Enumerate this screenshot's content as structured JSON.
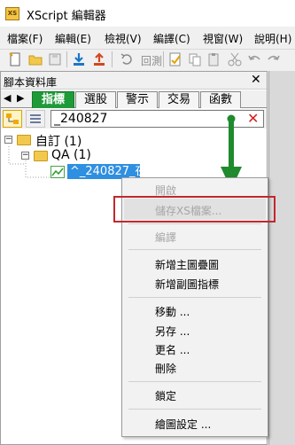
{
  "window": {
    "app_icon_text": "XS",
    "title": "XScript 編輯器"
  },
  "menubar": [
    "檔案(F)",
    "編輯(E)",
    "檢視(V)",
    "編譯(C)",
    "視窗(W)",
    "說明(H)"
  ],
  "toolbar": {
    "icons": [
      "new-file-icon",
      "open-folder-icon",
      "save-icon",
      "import-icon",
      "export-icon",
      "undo-icon",
      "backtest-icon",
      "compile-icon",
      "copy-icon",
      "paste-icon",
      "cut-icon",
      "delete-icon",
      "undo-arrow-icon",
      "redo-arrow-icon"
    ],
    "backtest_label": "回測"
  },
  "panel": {
    "title": "腳本資料庫",
    "close_glyph": "✕",
    "tabs": [
      "指標",
      "選股",
      "警示",
      "交易",
      "函數"
    ],
    "active_tab": "指標",
    "search": {
      "value": "_240827",
      "clear_glyph": "✕"
    }
  },
  "tree": {
    "expand_minus": "−",
    "root": "自訂 (1)",
    "child": "QA (1)",
    "item": "^_240827_夜盤"
  },
  "context_menu": {
    "items": [
      {
        "label": "開啟",
        "enabled": false
      },
      {
        "label": "儲存XS檔案...",
        "enabled": false
      },
      {
        "label": "編譯",
        "enabled": false
      },
      {
        "label": "新增主圖疊圖",
        "enabled": true
      },
      {
        "label": "新增副圖指標",
        "enabled": true
      },
      {
        "label": "移動 ...",
        "enabled": true
      },
      {
        "label": "另存 ...",
        "enabled": true
      },
      {
        "label": "更名 ...",
        "enabled": true
      },
      {
        "label": "刪除",
        "enabled": true
      },
      {
        "label": "鎖定",
        "enabled": true
      },
      {
        "label": "繪圖設定 ...",
        "enabled": true
      }
    ]
  },
  "colors": {
    "accent_green": "#1f9a39",
    "highlight_red": "#c0282d",
    "selection_blue": "#2f8fe0"
  }
}
